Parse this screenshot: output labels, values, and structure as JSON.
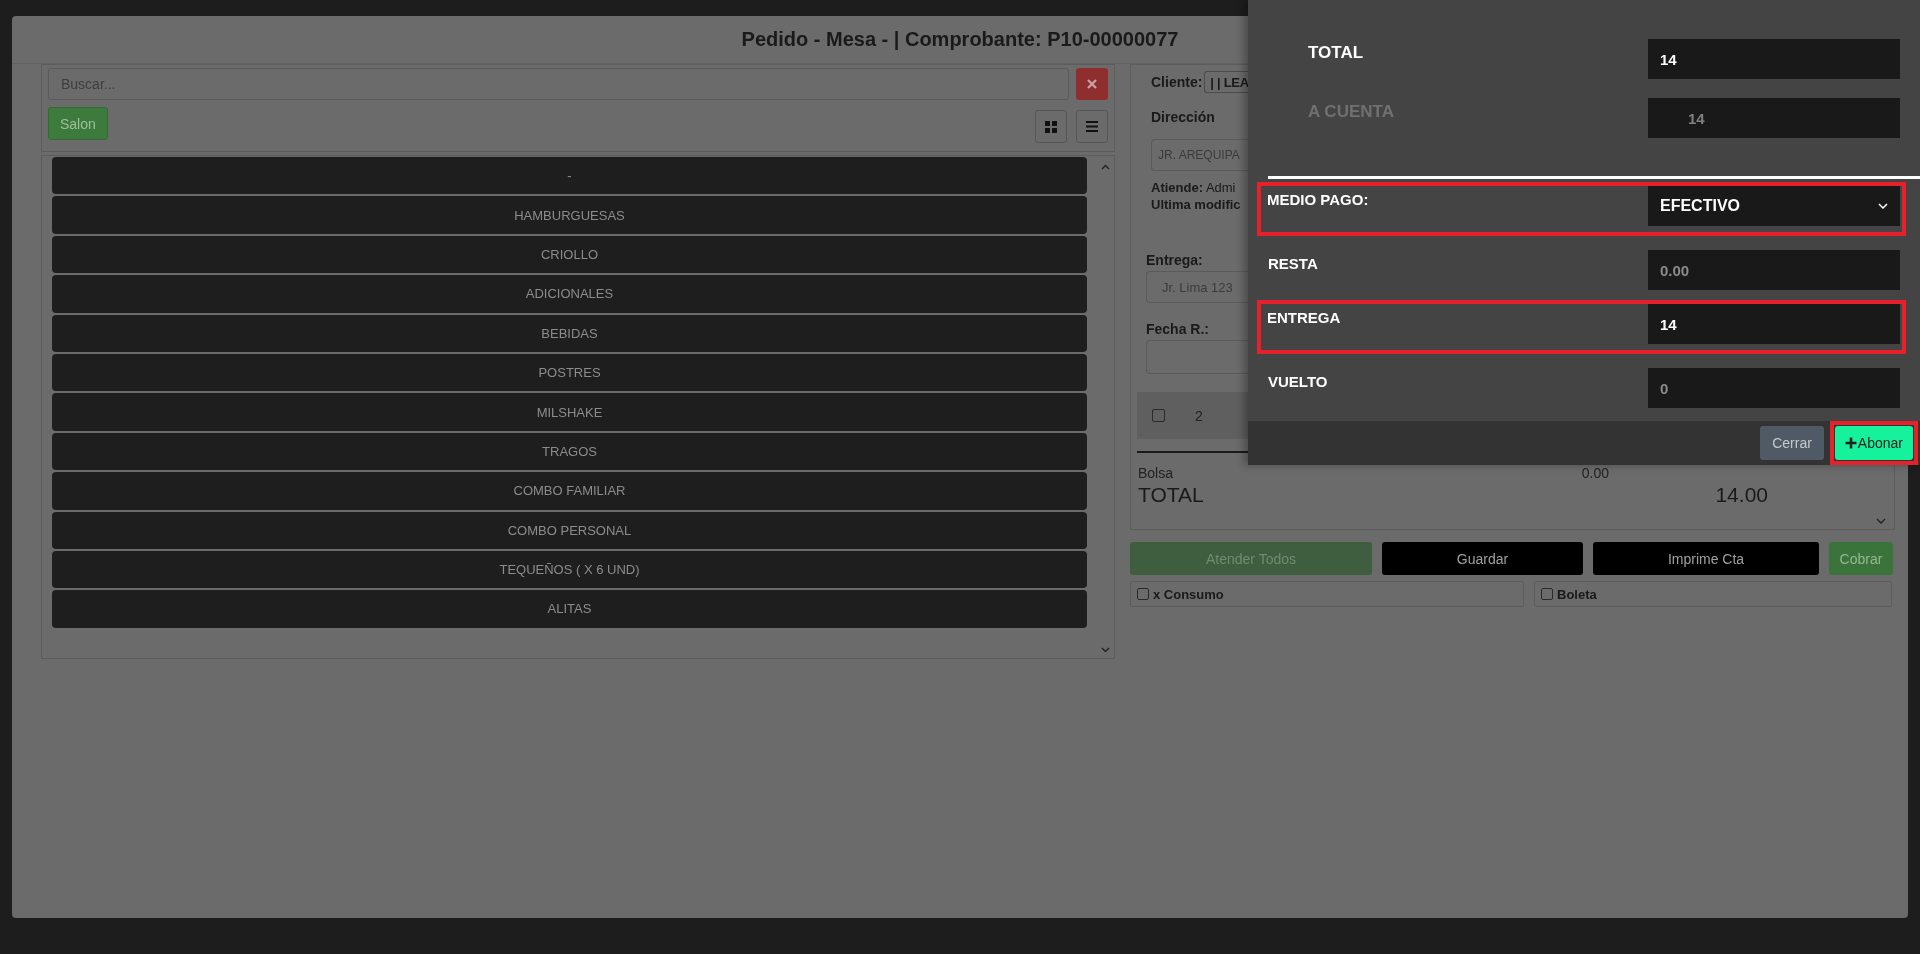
{
  "title": "Pedido - Mesa - | Comprobante: P10-00000077",
  "search": {
    "placeholder": "Buscar..."
  },
  "salon_button": "Salon",
  "categories": [
    "-",
    "HAMBURGUESAS",
    "CRIOLLO",
    "ADICIONALES",
    "BEBIDAS",
    "POSTRES",
    "MILSHAKE",
    "TRAGOS",
    "COMBO FAMILIAR",
    "COMBO PERSONAL",
    "TEQUEÑOS ( X 6 UND)",
    "ALITAS"
  ],
  "order": {
    "client_label": "Cliente:",
    "client_value": "| | LEA",
    "address_label": "Dirección",
    "address_value": "JR. AREQUIPA",
    "attends": "**Atiende:** Admi",
    "last_modified": "Ultima modific",
    "delivery_label": "Entrega:",
    "delivery_value": "Jr. Lima 123",
    "date_label": "Fecha R.:",
    "item": {
      "checked": false,
      "quantity": "2"
    },
    "bag": {
      "label": "Bolsa",
      "amount": "0.00"
    },
    "total": {
      "label": "TOTAL",
      "amount": "14.00"
    },
    "buttons": [
      {
        "label": "Atender Todos",
        "kind": "muted"
      },
      {
        "label": "Guardar",
        "kind": "dark"
      },
      {
        "label": "Imprime Cta",
        "kind": "dark"
      },
      {
        "label": "Cobrar",
        "kind": "success"
      }
    ],
    "options": [
      {
        "label": "x Consumo",
        "checked": false
      },
      {
        "label": "Boleta",
        "checked": false
      }
    ]
  },
  "payment_dialog": {
    "summary": [
      {
        "label": "TOTAL",
        "value": "14",
        "disabled": false
      },
      {
        "label": "A CUENTA",
        "value": "14",
        "disabled": true
      }
    ],
    "fields": [
      {
        "kind": "select",
        "label": "MEDIO PAGO:",
        "value": "EFECTIVO",
        "highlighted": true
      },
      {
        "kind": "input",
        "label": "RESTA",
        "value": "0.00",
        "readonly": true,
        "highlighted": false
      },
      {
        "kind": "input",
        "label": "ENTREGA",
        "value": "14",
        "readonly": false,
        "highlighted": true
      },
      {
        "kind": "input",
        "label": "VUELTO",
        "value": "0",
        "readonly": true,
        "highlighted": false
      }
    ],
    "close_button": "Cerrar",
    "submit_button": {
      "label": "Abonar",
      "highlighted": true
    }
  }
}
